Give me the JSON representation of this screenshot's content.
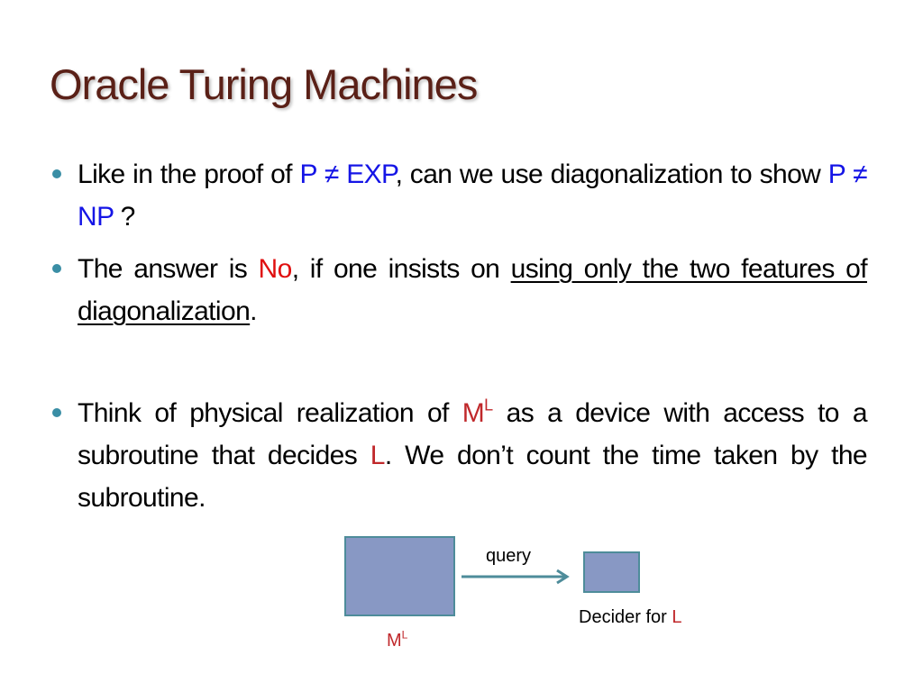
{
  "slide": {
    "title": "Oracle Turing Machines",
    "bullets": [
      {
        "parts": {
          "a": "Like in the proof of ",
          "b": "P ≠ EXP",
          "c": ", can we use diagonalization to show ",
          "d": "P ≠ NP",
          "e": " ?"
        }
      },
      {
        "parts": {
          "a": "The answer is ",
          "b": "No",
          "c": ", if one insists on ",
          "d": "using only the two features of diagonalization",
          "e": "."
        }
      },
      {
        "parts": {
          "a": "Think of physical realization of ",
          "b_base": "M",
          "b_sup": "L",
          "c": " as a device with access to a subroutine that decides ",
          "d": "L",
          "e": ". We don’t count the time taken by the subroutine."
        }
      }
    ],
    "diagram": {
      "arrow_label": "query",
      "machine_label_base": "M",
      "machine_label_sup": "L",
      "decider_label": "Decider for ",
      "decider_lang": "L"
    }
  }
}
